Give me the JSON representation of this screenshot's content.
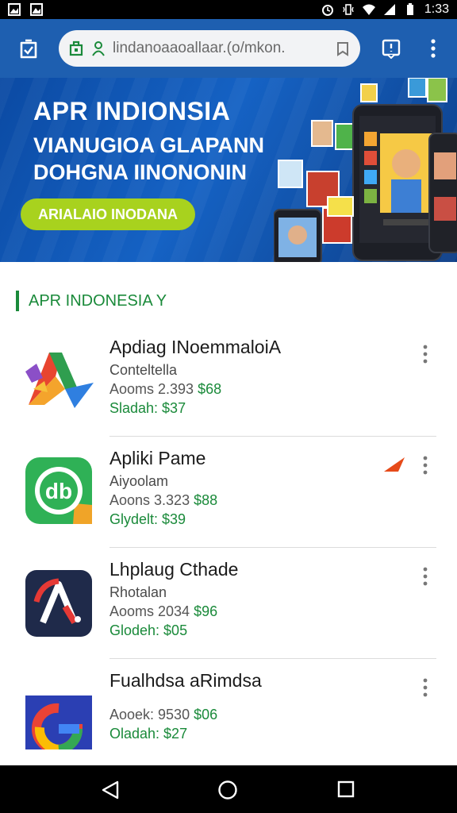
{
  "status_bar": {
    "time": "1:33"
  },
  "browser": {
    "url": "lindanoaaoallaar.(o/mkon."
  },
  "banner": {
    "title": "APR INDIONSIA",
    "line2": "VIANUGIOA GLAPANN",
    "line3": "DOHGNA IINONONIN",
    "cta": "ARIALAIO INODANA",
    "accent_color": "#a8d21e",
    "background_color": "#1562c4"
  },
  "section": {
    "title": "APR INDONESIA Y",
    "accent_color": "#1a8a3a"
  },
  "apps": [
    {
      "name": "Apdiag INoemmaloiA",
      "subtitle": "Conteltella",
      "price_label": "Aooms 2.393",
      "price_amount": "$68",
      "sale": "Sladah: $37",
      "icon": "multicolor-a-icon"
    },
    {
      "name": "Apliki Pame",
      "subtitle": "Aiyoolam",
      "price_label": "Aoons 3.323",
      "price_amount": "$88",
      "sale": "Glydelt: $39",
      "icon": "green-db-icon"
    },
    {
      "name": "Lhplaug Cthade",
      "subtitle": "Rhotalan",
      "price_label": "Aooms 2034",
      "price_amount": "$96",
      "sale": "Glodeh: $05",
      "icon": "navy-a-icon"
    },
    {
      "name": "Fualhdsa aRimdsa",
      "subtitle": "",
      "price_label": "Aooek: 9530",
      "price_amount": "$06",
      "sale": "Oladah: $27",
      "icon": "google-g-icon"
    }
  ]
}
